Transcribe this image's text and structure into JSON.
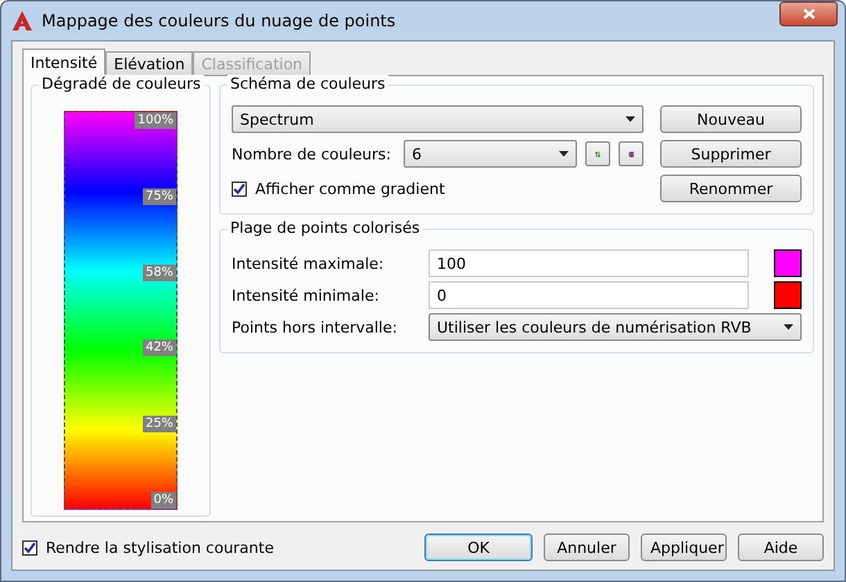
{
  "window": {
    "title": "Mappage des couleurs du nuage de points"
  },
  "tabs": [
    {
      "label": "Intensité",
      "selected": true,
      "disabled": false
    },
    {
      "label": "Elévation",
      "selected": false,
      "disabled": false
    },
    {
      "label": "Classification",
      "selected": false,
      "disabled": true
    }
  ],
  "gradient_group": {
    "title": "Dégradé de couleurs",
    "colors": [
      {
        "color": "#ff00ff"
      },
      {
        "color": "#0000ff"
      },
      {
        "color": "#00ffff"
      },
      {
        "color": "#00ff00"
      },
      {
        "color": "#ffff00"
      },
      {
        "color": "#ff0000"
      }
    ],
    "labels": [
      "100%",
      "75%",
      "58%",
      "42%",
      "25%",
      "0%"
    ]
  },
  "scheme_group": {
    "title": "Schéma de couleurs",
    "scheme": "Spectrum",
    "count_label": "Nombre de couleurs:",
    "count": "6",
    "gradient_checkbox": {
      "label": "Afficher comme gradient",
      "checked": true
    },
    "buttons": [
      "Nouveau",
      "Supprimer",
      "Renommer"
    ]
  },
  "range_group": {
    "title": "Plage de points colorisés",
    "fields": [
      {
        "label": "Intensité maximale:",
        "value": "100",
        "color": "#ff00ff"
      },
      {
        "label": "Intensité minimale:",
        "value": "0",
        "color": "#ff0000"
      }
    ],
    "outside_label": "Points hors intervalle:",
    "outside_value": "Utiliser les couleurs de numérisation RVB"
  },
  "footer": {
    "checkbox": {
      "label": "Rendre la stylisation courante",
      "checked": true
    },
    "buttons": [
      {
        "label": "OK",
        "default": true
      },
      {
        "label": "Annuler",
        "default": false
      },
      {
        "label": "Appliquer",
        "default": false
      },
      {
        "label": "Aide",
        "default": false
      }
    ]
  }
}
